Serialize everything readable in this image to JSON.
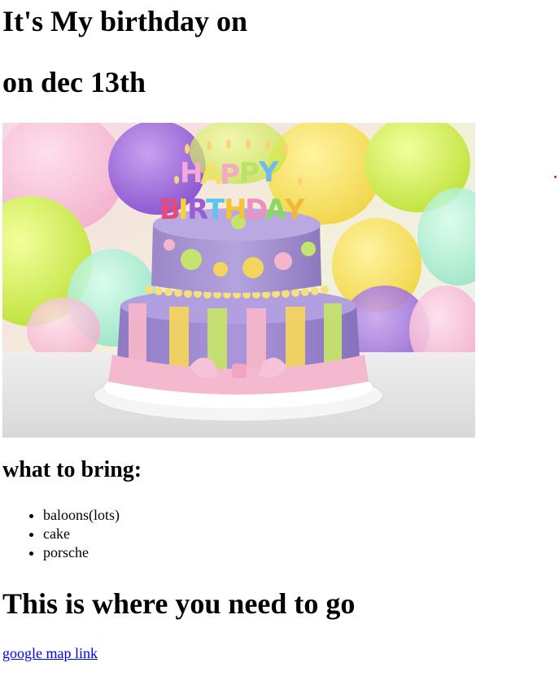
{
  "heading_line1": "It's My birthday on",
  "heading_line2": "on dec 13th",
  "image": {
    "icon": "birthday-cake-image",
    "candle_text_top": "HAPPY",
    "candle_text_bottom": "BIRTHDAY"
  },
  "bring_heading": "what to bring:",
  "bring_items": [
    "baloons(lots)",
    "cake",
    "porsche"
  ],
  "where_heading": "This is where you need to go",
  "map_link_text": "google map link",
  "colors": {
    "link": "#0000ee",
    "cake_purple": "#a78fcf",
    "balloon_green": "#d8f05a",
    "balloon_purple": "#9d6bd6",
    "frosting_pink": "#f4b8cf"
  }
}
